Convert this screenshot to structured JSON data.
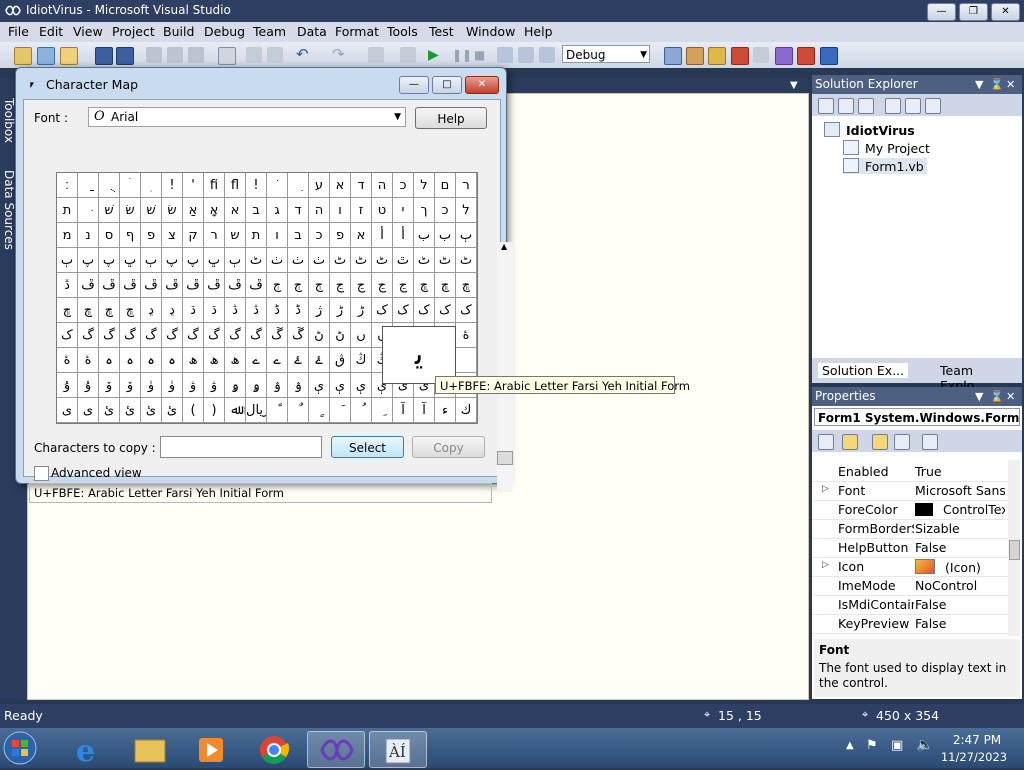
{
  "window": {
    "title": "IdiotVirus - Microsoft Visual Studio"
  },
  "menu": [
    "File",
    "Edit",
    "View",
    "Project",
    "Build",
    "Debug",
    "Team",
    "Data",
    "Format",
    "Tools",
    "Test",
    "Window",
    "Help"
  ],
  "toolbar": {
    "config_value": "Debug"
  },
  "side_strip": {
    "toolbox": "Toolbox",
    "data_sources": "Data Sources"
  },
  "solution_explorer": {
    "title": "Solution Explorer",
    "project": "IdiotVirus",
    "items": [
      "My Project",
      "Form1.vb"
    ],
    "tabs": [
      "Solution Ex...",
      "Team Explo..."
    ]
  },
  "properties": {
    "title": "Properties",
    "object": "Form1  System.Windows.Forms.Fo",
    "rows": [
      {
        "name": "Enabled",
        "value": "True",
        "expand": false,
        "swatch": null
      },
      {
        "name": "Font",
        "value": "Microsoft Sans S",
        "expand": true,
        "swatch": null
      },
      {
        "name": "ForeColor",
        "value": "ControlTex",
        "expand": false,
        "swatch": "#000000"
      },
      {
        "name": "FormBorderSt",
        "value": "Sizable",
        "expand": false,
        "swatch": null
      },
      {
        "name": "HelpButton",
        "value": "False",
        "expand": false,
        "swatch": null
      },
      {
        "name": "Icon",
        "value": "(Icon)",
        "expand": true,
        "swatch": "icon"
      },
      {
        "name": "ImeMode",
        "value": "NoControl",
        "expand": false,
        "swatch": null
      },
      {
        "name": "IsMdiContain",
        "value": "False",
        "expand": false,
        "swatch": null
      },
      {
        "name": "KeyPreview",
        "value": "False",
        "expand": false,
        "swatch": null
      }
    ],
    "desc_title": "Font",
    "desc_text": "The font used to display text in the control."
  },
  "status": {
    "ready": "Ready",
    "position": "15 , 15",
    "size": "450 x 354"
  },
  "clock": {
    "time": "2:47 PM",
    "date": "11/27/2023"
  },
  "charmap": {
    "title": "Character Map",
    "font_label": "Font :",
    "font_value": "Arial",
    "help": "Help",
    "copy_label": "Characters to copy :",
    "copy_value": "",
    "select": "Select",
    "copy": "Copy",
    "advanced": "Advanced view",
    "status": "U+FBFE: Arabic Letter Farsi Yeh Initial Form",
    "tooltip": "U+FBFE: Arabic Letter Farsi Yeh Initial Form",
    "zoom_char": "ﯾ",
    "rows": [
      [
        "׃",
        "ַ",
        "ֻ",
        "ׄ",
        "ׅ",
        "!",
        "'",
        "ﬁ",
        "ﬂ",
        "!",
        "ֹ",
        "ִ",
        "ע",
        "א",
        "ד",
        "ה",
        "כ",
        "ל",
        "ם",
        "ר"
      ],
      [
        "ת",
        "ּ",
        "שׁ",
        "שׂ",
        "שׁ",
        "שׂ",
        "אַ",
        "אָ",
        "א",
        "ב",
        "ג",
        "ד",
        "ה",
        "ו",
        "ז",
        "ט",
        "י",
        "ך",
        "כ",
        "ל"
      ],
      [
        "מ",
        "נ",
        "ס",
        "ף",
        "פ",
        "צ",
        "ק",
        "ר",
        "ש",
        "ת",
        "ו",
        "ב",
        "כ",
        "פ",
        "א",
        "أ",
        "أ",
        "ب",
        "ب",
        "ٻ"
      ],
      [
        "ٻ",
        "پ",
        "پ",
        "ڀ",
        "ٻ",
        "پ",
        "پ",
        "ڀ",
        "ٻ",
        "ٹ",
        "ٺ",
        "ٺ",
        "ٺ",
        "ٹ",
        "ٹ",
        "ٹ",
        "ٿ",
        "ٹ",
        "ٹ",
        "ٹ"
      ],
      [
        "ڐ",
        "ڦ",
        "ڦ",
        "ڦ",
        "ڦ",
        "ڦ",
        "ڦ",
        "ڦ",
        "ڦ",
        "ڦ",
        "ڄ",
        "ڄ",
        "ڄ",
        "ڃ",
        "ڃ",
        "ڃ",
        "ڃ",
        "ڇ",
        "ڇ",
        "ڇ"
      ],
      [
        "ڇ",
        "ڇ",
        "ڇ",
        "ڇ",
        "ڍ",
        "ڍ",
        "ڌ",
        "ڌ",
        "ڎ",
        "ڎ",
        "ڈ",
        "ڈ",
        "ژ",
        "ڑ",
        "ڑ",
        "ک",
        "ک",
        "ک",
        "ک",
        "ک"
      ],
      [
        "ک",
        "گ",
        "گ",
        "گ",
        "گ",
        "گ",
        "گ",
        "گ",
        "گ",
        "گ",
        "ڱ",
        "ڱ",
        "ڻ",
        "ڻ",
        "ں",
        "ں",
        "ڻ",
        "ڻ",
        "ۀ",
        "ۀ"
      ],
      [
        "ۀ",
        "ۀ",
        "ہ",
        "ہ",
        "ہ",
        "ہ",
        "ھ",
        "ھ",
        "ھ",
        "ے",
        "ے",
        "ۓ",
        "ۓ",
        "ڨ",
        "ڭ",
        "ڭ",
        "",
        "",
        "",
        ""
      ],
      [
        "ۇ",
        "ۇ",
        "ۆ",
        "ۆ",
        "ۈ",
        "ۈ",
        "ۋ",
        "ۋ",
        "ۅ",
        "ۅ",
        "ۉ",
        "ۉ",
        "ې",
        "ې",
        "ې",
        "ې",
        "ی",
        "ی",
        "",
        "ﯾ"
      ],
      [
        "ى",
        "ى",
        "ئ",
        "ئ",
        "ئ",
        "ئ",
        "(",
        ")",
        "ﷲ",
        "ریال",
        "ً",
        "ٌ",
        "ٍ",
        "َ",
        "ُ",
        "ِ",
        "آ",
        "آ",
        "ء",
        "ك"
      ]
    ]
  }
}
